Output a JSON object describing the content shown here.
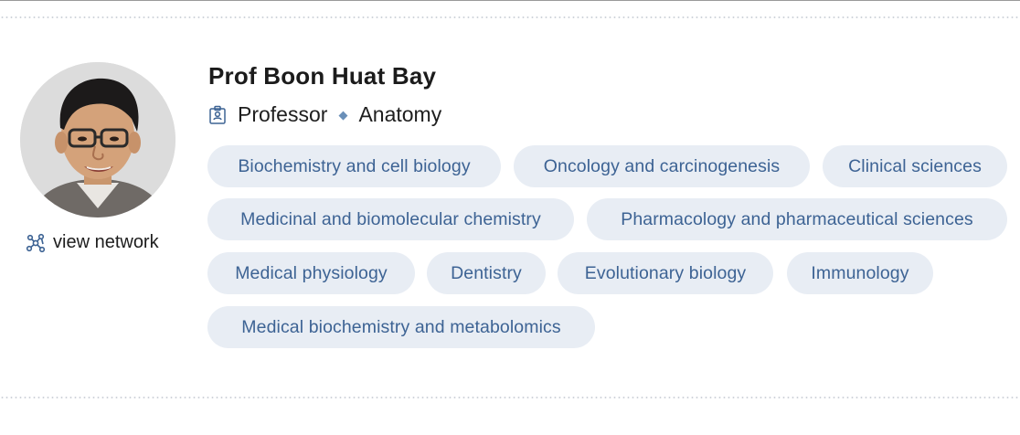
{
  "profile": {
    "name": "Prof Boon Huat Bay",
    "position": "Professor",
    "department": "Anatomy",
    "separator": "◆",
    "view_network_label": "view network",
    "avatar": "person-photo"
  },
  "icons": {
    "position": "id-badge-icon",
    "network": "network-icon"
  },
  "research_areas": [
    "Biochemistry and cell biology",
    "Oncology and carcinogenesis",
    "Clinical sciences",
    "Medicinal and biomolecular chemistry",
    "Pharmacology and pharmaceutical sciences",
    "Medical physiology",
    "Dentistry",
    "Evolutionary biology",
    "Immunology",
    "Medical biochemistry and metabolomics"
  ],
  "colors": {
    "chip_background": "#e8edf4",
    "chip_text": "#3d6394",
    "accent": "#6a8fb8",
    "name_text": "#1b1b1b"
  }
}
